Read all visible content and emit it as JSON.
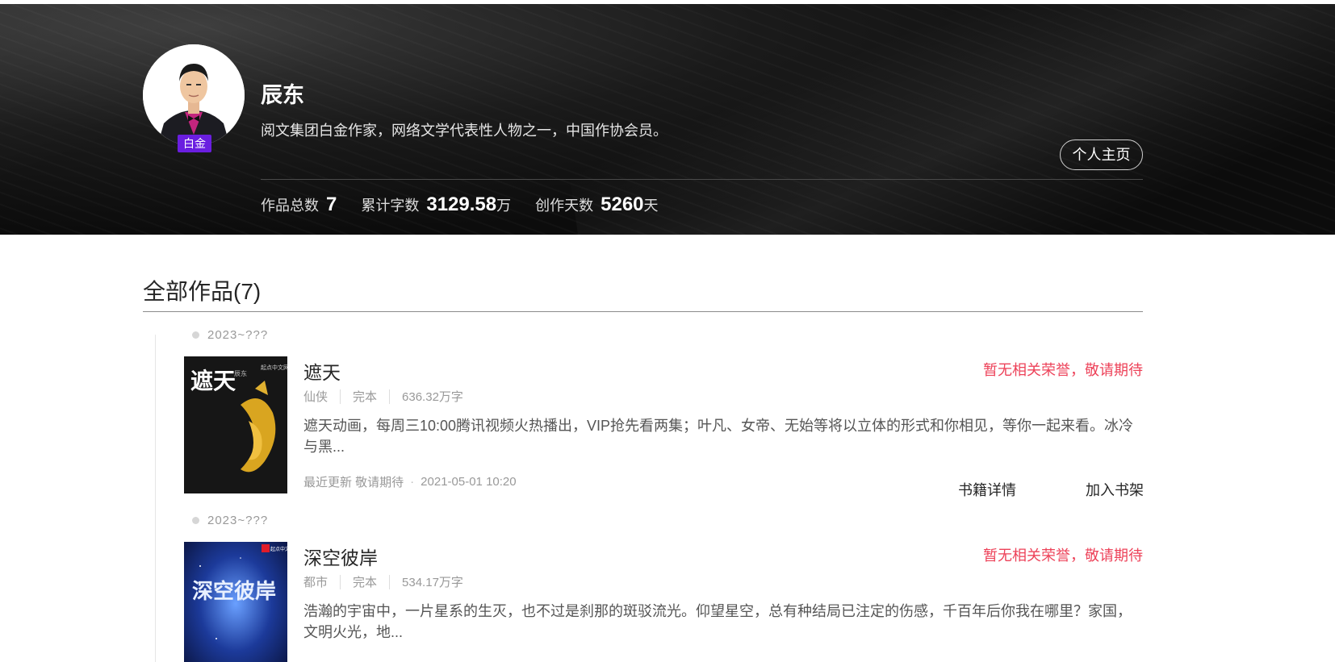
{
  "author": {
    "name": "辰东",
    "level_badge": "白金",
    "intro": "阅文集团白金作家，网络文学代表性人物之一，中国作协会员。",
    "home_button": "个人主页",
    "stats": {
      "works_label": "作品总数",
      "works_value": "7",
      "words_label": "累计字数",
      "words_value": "3129.58",
      "words_unit": "万",
      "days_label": "创作天数",
      "days_value": "5260",
      "days_unit": "天"
    }
  },
  "works_section": {
    "title": "全部作品(7)"
  },
  "books": [
    {
      "year": "2023~???",
      "title": "遮天",
      "honor": "暂无相关荣誉，敬请期待",
      "genre": "仙侠",
      "status": "完本",
      "word_count": "636.32万字",
      "description": "遮天动画，每周三10:00腾讯视频火热播出，VIP抢先看两集；叶凡、女帝、无始等将以立体的形式和你相见，等你一起来看。冰冷与黑...",
      "update_label": "最近更新 敬请期待",
      "update_time": "2021-05-01 10:20",
      "detail_button": "书籍详情",
      "shelf_button": "加入书架",
      "cover_text": "遮天",
      "cover_author": "辰东",
      "cover_publisher": "起点中文网"
    },
    {
      "year": "2023~???",
      "title": "深空彼岸",
      "honor": "暂无相关荣誉，敬请期待",
      "genre": "都市",
      "status": "完本",
      "word_count": "534.17万字",
      "description": "浩瀚的宇宙中，一片星系的生灭，也不过是刹那的斑驳流光。仰望星空，总有种结局已注定的伤感，千百年后你我在哪里？家国，文明火光，地...",
      "cover_text": "深空彼岸",
      "cover_publisher": "起点中文网"
    }
  ],
  "colors": {
    "honor": "#ed4259",
    "badge": "#6a1ee0"
  }
}
